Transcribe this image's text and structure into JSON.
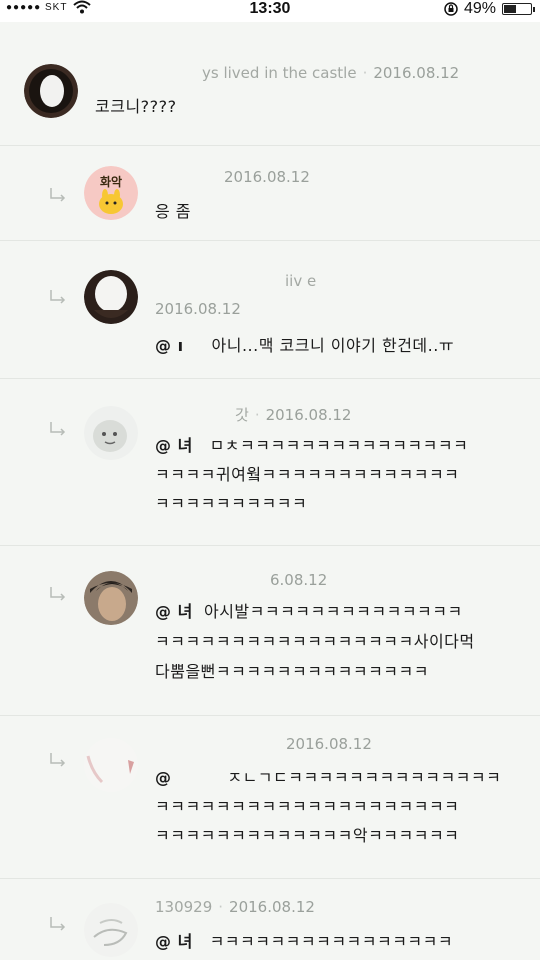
{
  "status_bar": {
    "carrier": "●●●●● SKT",
    "time": "13:30",
    "battery": "49%",
    "battery_level": 0.49
  },
  "comments": [
    {
      "author": "ys lived in the castle",
      "date": "2016.08.12",
      "lines": [
        "코크니????"
      ],
      "avatar_icon": "dark-ring-avatar-icon",
      "is_reply": false
    },
    {
      "author": "",
      "date": "2016.08.12",
      "lines": [
        "응 좀"
      ],
      "avatar_icon": "character-avatar-icon",
      "avatar_label": "화악",
      "is_reply": true
    },
    {
      "author": "iiv          e",
      "date": "2016.08.12",
      "lines": [
        "아니...맥 코크니 이야기 한건데..ㅠ"
      ],
      "mention": "@ ı",
      "avatar_icon": "dark-ring-avatar-icon",
      "is_reply": true
    },
    {
      "author": "갓",
      "date": "2016.08.12",
      "mention": "@ 녀",
      "lines": [
        "ㅁㅊㅋㅋㅋㅋㅋㅋㅋㅋㅋㅋㅋㅋㅋㅋㅋ",
        "ㅋㅋㅋㅋ귀여웤ㅋㅋㅋㅋㅋㅋㅋㅋㅋㅋㅋㅋㅋ",
        "ㅋㅋㅋㅋㅋㅋㅋㅋㅋㅋ"
      ],
      "avatar_icon": "character-avatar-icon",
      "is_reply": true
    },
    {
      "author": "",
      "date": "6.08.12",
      "mention": "@ 녀",
      "lines": [
        "아시발ㅋㅋㅋㅋㅋㅋㅋㅋㅋㅋㅋㅋㅋㅋ",
        "ㅋㅋㅋㅋㅋㅋㅋㅋㅋㅋㅋㅋㅋㅋㅋㅋㅋ사이다먹",
        "다뿜을뻔ㅋㅋㅋㅋㅋㅋㅋㅋㅋㅋㅋㅋㅋㅋ"
      ],
      "avatar_icon": "photo-avatar-icon",
      "is_reply": true
    },
    {
      "author": "",
      "date": "2016.08.12",
      "mention": "@",
      "lines": [
        "ㅈㄴㄱㄷㅋㅋㅋㅋㅋㅋㅋㅋㅋㅋㅋㅋㅋㅋ",
        "ㅋㅋㅋㅋㅋㅋㅋㅋㅋㅋㅋㅋㅋㅋㅋㅋㅋㅋㅋㅋ",
        "ㅋㅋㅋㅋㅋㅋㅋㅋㅋㅋㅋㅋㅋ악ㅋㅋㅋㅋㅋㅋ"
      ],
      "avatar_icon": "photo-avatar-icon",
      "is_reply": true
    },
    {
      "author": "130929",
      "date": "2016.08.12",
      "mention": "@ 녀",
      "lines": [
        "ㅋㅋㅋㅋㅋㅋㅋㅋㅋㅋㅋㅋㅋㅋㅋㅋ"
      ],
      "avatar_icon": "sketch-avatar-icon",
      "is_reply": true
    }
  ]
}
